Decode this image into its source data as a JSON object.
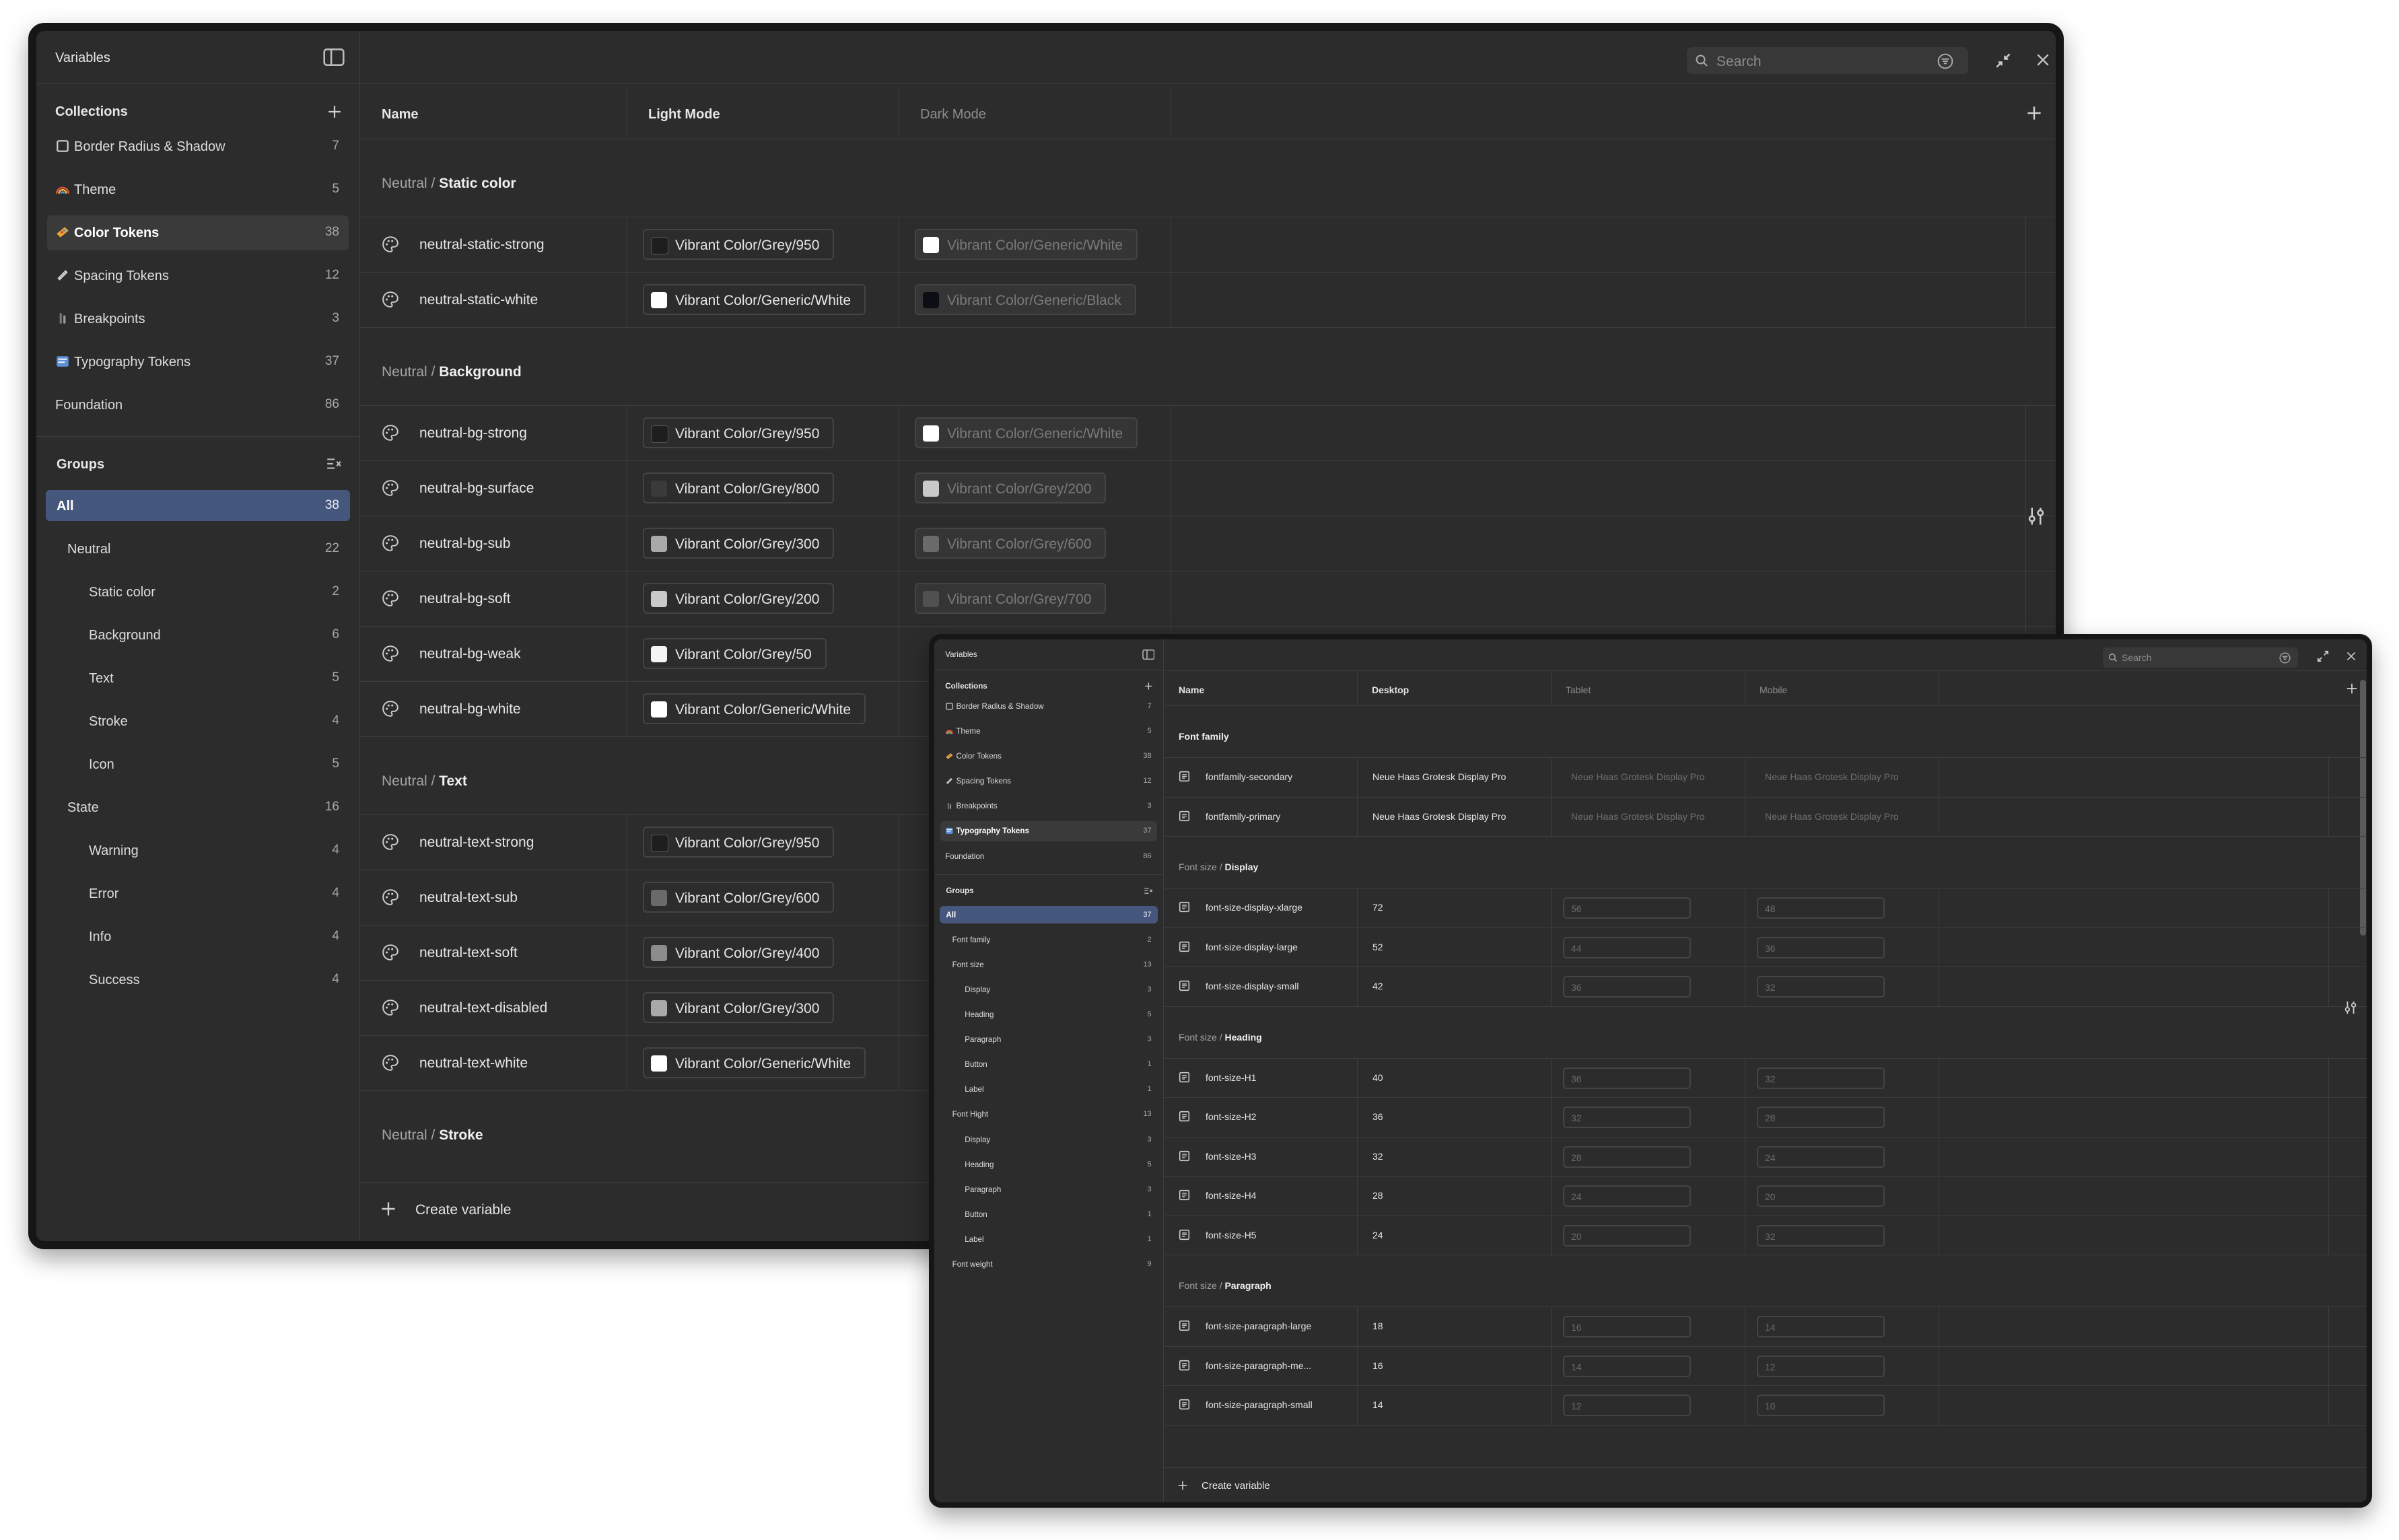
{
  "win1": {
    "title": "Variables",
    "collections_heading": "Collections",
    "collections": [
      {
        "icon": "square-icon",
        "label": "Border Radius & Shadow",
        "count": "7"
      },
      {
        "icon": "rainbow-icon",
        "label": "Theme",
        "count": "5"
      },
      {
        "icon": "palette-icon",
        "label": "Color Tokens",
        "count": "38",
        "selected": true
      },
      {
        "icon": "ruler-icon",
        "label": "Spacing Tokens",
        "count": "12"
      },
      {
        "icon": "breakpoints-icon",
        "label": "Breakpoints",
        "count": "3"
      },
      {
        "icon": "typography-icon",
        "label": "Typography Tokens",
        "count": "37"
      },
      {
        "icon": "",
        "label": "Foundation",
        "count": "86"
      }
    ],
    "groups_heading": "Groups",
    "groups": [
      {
        "label": "All",
        "count": "38",
        "level": 0,
        "selected": true
      },
      {
        "label": "Neutral",
        "count": "22",
        "level": 1
      },
      {
        "label": "Static color",
        "count": "2",
        "level": 2
      },
      {
        "label": "Background",
        "count": "6",
        "level": 2
      },
      {
        "label": "Text",
        "count": "5",
        "level": 2
      },
      {
        "label": "Stroke",
        "count": "4",
        "level": 2
      },
      {
        "label": "Icon",
        "count": "5",
        "level": 2
      },
      {
        "label": "State",
        "count": "16",
        "level": 1
      },
      {
        "label": "Warning",
        "count": "4",
        "level": 2
      },
      {
        "label": "Error",
        "count": "4",
        "level": 2
      },
      {
        "label": "Info",
        "count": "4",
        "level": 2
      },
      {
        "label": "Success",
        "count": "4",
        "level": 2
      }
    ],
    "search_placeholder": "Search",
    "columns": [
      "Name",
      "Light Mode",
      "Dark Mode"
    ],
    "sections": [
      {
        "prefix": "Neutral / ",
        "name": "Static color",
        "rows": [
          {
            "name": "neutral-static-strong",
            "light": "Vibrant Color/Grey/950",
            "light_color": "#1e1e1e",
            "dark": "Vibrant Color/Generic/White",
            "dark_color": "#ffffff"
          },
          {
            "name": "neutral-static-white",
            "light": "Vibrant Color/Generic/White",
            "light_color": "#ffffff",
            "dark": "Vibrant Color/Generic/Black",
            "dark_color": "#0d0d14"
          }
        ]
      },
      {
        "prefix": "Neutral / ",
        "name": "Background",
        "rows": [
          {
            "name": "neutral-bg-strong",
            "light": "Vibrant Color/Grey/950",
            "light_color": "#1e1e1e",
            "dark": "Vibrant Color/Generic/White",
            "dark_color": "#ffffff"
          },
          {
            "name": "neutral-bg-surface",
            "light": "Vibrant Color/Grey/800",
            "light_color": "#3a3a3a",
            "dark": "Vibrant Color/Grey/200",
            "dark_color": "#c9c9c9"
          },
          {
            "name": "neutral-bg-sub",
            "light": "Vibrant Color/Grey/300",
            "light_color": "#a9a9a9",
            "dark": "Vibrant Color/Grey/600",
            "dark_color": "#6a6a6a"
          },
          {
            "name": "neutral-bg-soft",
            "light": "Vibrant Color/Grey/200",
            "light_color": "#c9c9c9",
            "dark": "Vibrant Color/Grey/700",
            "dark_color": "#505050"
          },
          {
            "name": "neutral-bg-weak",
            "light": "Vibrant Color/Grey/50",
            "light_color": "#f4f4f4",
            "dark": "",
            "dark_color": ""
          },
          {
            "name": "neutral-bg-white",
            "light": "Vibrant Color/Generic/White",
            "light_color": "#ffffff",
            "dark": "",
            "dark_color": ""
          }
        ]
      },
      {
        "prefix": "Neutral / ",
        "name": "Text",
        "rows": [
          {
            "name": "neutral-text-strong",
            "light": "Vibrant Color/Grey/950",
            "light_color": "#1e1e1e",
            "dark": "",
            "dark_color": ""
          },
          {
            "name": "neutral-text-sub",
            "light": "Vibrant Color/Grey/600",
            "light_color": "#6a6a6a",
            "dark": "",
            "dark_color": ""
          },
          {
            "name": "neutral-text-soft",
            "light": "Vibrant Color/Grey/400",
            "light_color": "#8c8c8c",
            "dark": "",
            "dark_color": ""
          },
          {
            "name": "neutral-text-disabled",
            "light": "Vibrant Color/Grey/300",
            "light_color": "#a9a9a9",
            "dark": "",
            "dark_color": ""
          },
          {
            "name": "neutral-text-white",
            "light": "Vibrant Color/Generic/White",
            "light_color": "#ffffff",
            "dark": "",
            "dark_color": ""
          }
        ]
      },
      {
        "prefix": "Neutral / ",
        "name": "Stroke",
        "rows": []
      }
    ],
    "create_variable": "Create variable"
  },
  "win2": {
    "title": "Variables",
    "collections_heading": "Collections",
    "collections": [
      {
        "icon": "square-icon",
        "label": "Border Radius & Shadow",
        "count": "7"
      },
      {
        "icon": "rainbow-icon",
        "label": "Theme",
        "count": "5"
      },
      {
        "icon": "palette-icon",
        "label": "Color Tokens",
        "count": "38"
      },
      {
        "icon": "ruler-icon",
        "label": "Spacing Tokens",
        "count": "12"
      },
      {
        "icon": "breakpoints-icon",
        "label": "Breakpoints",
        "count": "3"
      },
      {
        "icon": "typography-icon",
        "label": "Typography Tokens",
        "count": "37",
        "selected": true
      },
      {
        "icon": "",
        "label": "Foundation",
        "count": "86"
      }
    ],
    "groups_heading": "Groups",
    "groups": [
      {
        "label": "All",
        "count": "37",
        "level": 0,
        "selected": true
      },
      {
        "label": "Font family",
        "count": "2",
        "level": 1
      },
      {
        "label": "Font size",
        "count": "13",
        "level": 1
      },
      {
        "label": "Display",
        "count": "3",
        "level": 2
      },
      {
        "label": "Heading",
        "count": "5",
        "level": 2
      },
      {
        "label": "Paragraph",
        "count": "3",
        "level": 2
      },
      {
        "label": "Button",
        "count": "1",
        "level": 2
      },
      {
        "label": "Label",
        "count": "1",
        "level": 2
      },
      {
        "label": "Font Hight",
        "count": "13",
        "level": 1
      },
      {
        "label": "Display",
        "count": "3",
        "level": 2
      },
      {
        "label": "Heading",
        "count": "5",
        "level": 2
      },
      {
        "label": "Paragraph",
        "count": "3",
        "level": 2
      },
      {
        "label": "Button",
        "count": "1",
        "level": 2
      },
      {
        "label": "Label",
        "count": "1",
        "level": 2
      },
      {
        "label": "Font weight",
        "count": "9",
        "level": 1
      }
    ],
    "search_placeholder": "Search",
    "columns": [
      "Name",
      "Desktop",
      "Tablet",
      "Mobile"
    ],
    "sections": [
      {
        "prefix": "",
        "name": "Font family",
        "rows": [
          {
            "name": "fontfamily-secondary",
            "desktop": "Neue Haas Grotesk Display Pro",
            "tablet": "Neue Haas Grotesk Display Pro",
            "mobile": "Neue Haas Grotesk Display Pro",
            "boxed": false
          },
          {
            "name": "fontfamily-primary",
            "desktop": "Neue Haas Grotesk Display Pro",
            "tablet": "Neue Haas Grotesk Display Pro",
            "mobile": "Neue Haas Grotesk Display Pro",
            "boxed": false
          }
        ]
      },
      {
        "prefix": "Font size / ",
        "name": "Display",
        "rows": [
          {
            "name": "font-size-display-xlarge",
            "desktop": "72",
            "tablet": "56",
            "mobile": "48",
            "boxed": true
          },
          {
            "name": "font-size-display-large",
            "desktop": "52",
            "tablet": "44",
            "mobile": "36",
            "boxed": true
          },
          {
            "name": "font-size-display-small",
            "desktop": "42",
            "tablet": "36",
            "mobile": "32",
            "boxed": true
          }
        ]
      },
      {
        "prefix": "Font size / ",
        "name": "Heading",
        "rows": [
          {
            "name": "font-size-H1",
            "desktop": "40",
            "tablet": "36",
            "mobile": "32",
            "boxed": true
          },
          {
            "name": "font-size-H2",
            "desktop": "36",
            "tablet": "32",
            "mobile": "28",
            "boxed": true
          },
          {
            "name": "font-size-H3",
            "desktop": "32",
            "tablet": "28",
            "mobile": "24",
            "boxed": true
          },
          {
            "name": "font-size-H4",
            "desktop": "28",
            "tablet": "24",
            "mobile": "20",
            "boxed": true
          },
          {
            "name": "font-size-H5",
            "desktop": "24",
            "tablet": "20",
            "mobile": "32",
            "boxed": true
          }
        ]
      },
      {
        "prefix": "Font size / ",
        "name": "Paragraph",
        "rows": [
          {
            "name": "font-size-paragraph-large",
            "desktop": "18",
            "tablet": "16",
            "mobile": "14",
            "boxed": true
          },
          {
            "name": "font-size-paragraph-me...",
            "desktop": "16",
            "tablet": "14",
            "mobile": "12",
            "boxed": true
          },
          {
            "name": "font-size-paragraph-small",
            "desktop": "14",
            "tablet": "12",
            "mobile": "10",
            "boxed": true
          }
        ]
      }
    ],
    "create_variable": "Create variable"
  }
}
